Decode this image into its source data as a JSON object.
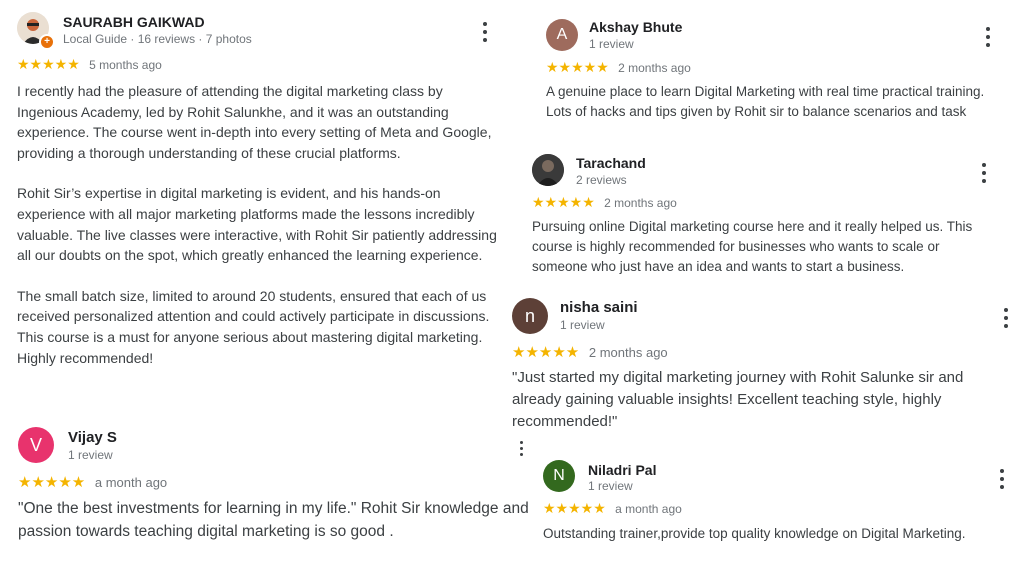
{
  "reviews": [
    {
      "name": "SAURABH GAIKWAD",
      "meta": "Local Guide · 16 reviews · 7 photos",
      "stars": "★★★★★",
      "ago": "5 months ago",
      "paragraphs": [
        "I recently had the pleasure of attending the digital marketing class by Ingenious Academy, led by Rohit Salunkhe, and it was an outstanding experience. The course went in-depth into every setting of Meta and Google, providing a thorough understanding of these crucial platforms.",
        "Rohit Sir’s expertise in digital marketing is evident, and his hands-on experience with all major marketing platforms made the lessons incredibly valuable. The live classes were interactive, with Rohit Sir patiently addressing all our doubts on the spot, which greatly enhanced the learning experience.",
        "The small batch size, limited to around 20 students, ensured that each of us received personalized attention and could actively participate in discussions. This course is a must for anyone serious about mastering digital marketing. Highly recommended!"
      ]
    },
    {
      "avatar_letter": "V",
      "avatar_color": "#e8336d",
      "name": "Vijay S",
      "meta": "1 review",
      "stars": "★★★★★",
      "ago": "a month ago",
      "text": "\"One the best investments for learning in my life.\" Rohit Sir knowledge and passion towards teaching digital marketing is so good ."
    },
    {
      "avatar_letter": "A",
      "avatar_color": "#9e6b5d",
      "name": "Akshay Bhute",
      "meta": "1 review",
      "stars": "★★★★★",
      "ago": "2 months ago",
      "text": "A genuine place to learn Digital Marketing with real time practical training. Lots of hacks and tips given by Rohit sir to balance scenarios and task"
    },
    {
      "name": "Tarachand",
      "meta": "2 reviews",
      "stars": "★★★★★",
      "ago": "2 months ago",
      "text": "Pursuing online Digital marketing course here and it really helped us. This course is highly recommended for businesses who wants to scale or someone who just have an idea and wants to start a business."
    },
    {
      "avatar_letter": "n",
      "avatar_color": "#5d4037",
      "name": "nisha saini",
      "meta": "1 review",
      "stars": "★★★★★",
      "ago": "2 months ago",
      "text": "\"Just started my digital marketing journey with Rohit Salunke sir and already gaining valuable insights! Excellent teaching style, highly recommended!\""
    },
    {
      "avatar_letter": "N",
      "avatar_color": "#33691e",
      "name": "Niladri Pal",
      "meta": "1 review",
      "stars": "★★★★★",
      "ago": "a month ago",
      "text": "Outstanding trainer,provide top quality knowledge on Digital Marketing."
    }
  ]
}
